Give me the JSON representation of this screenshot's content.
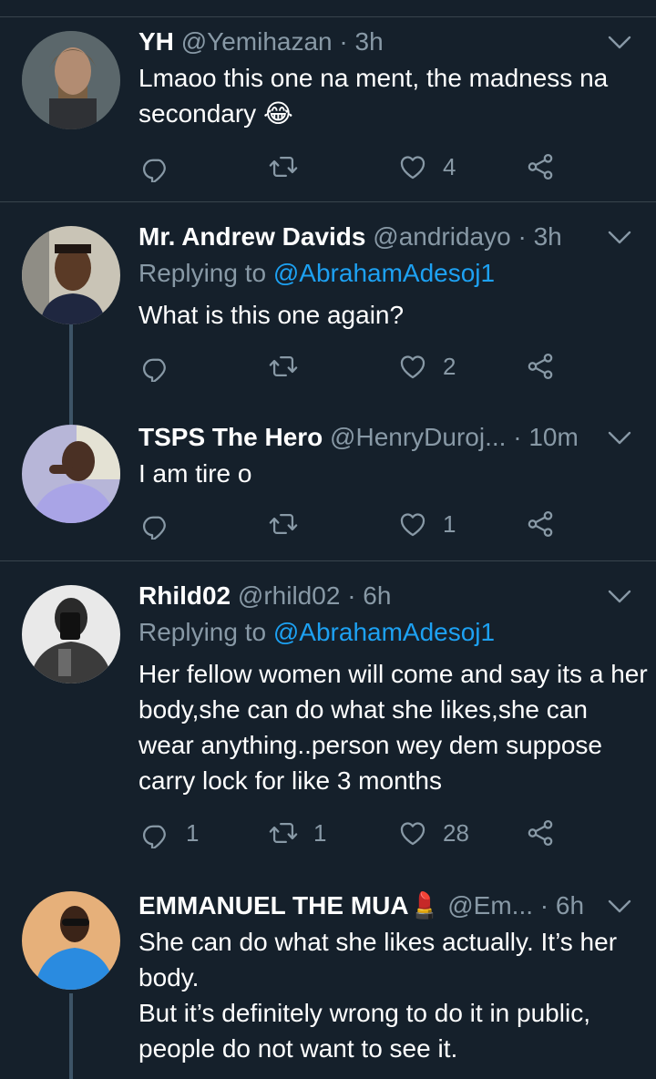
{
  "tweets": [
    {
      "name": "YH",
      "handle": "@Yemihazan",
      "time": "3h",
      "reply_to_label": "",
      "reply_to_mention": "",
      "text": "Lmaoo this one na ment, the madness na secondary 😂",
      "reply_count": "",
      "retweet_count": "",
      "like_count": "4"
    },
    {
      "name": "Mr. Andrew Davids",
      "handle": "@andridayo",
      "time": "3h",
      "reply_to_label": "Replying to ",
      "reply_to_mention": "@AbrahamAdesoj1",
      "text": "What is this one again?",
      "reply_count": "",
      "retweet_count": "",
      "like_count": "2"
    },
    {
      "name": "TSPS The Hero",
      "handle": "@HenryDuroj...",
      "time": "10m",
      "reply_to_label": "",
      "reply_to_mention": "",
      "text": "I am tire o",
      "reply_count": "",
      "retweet_count": "",
      "like_count": "1"
    },
    {
      "name": "Rhild02",
      "handle": "@rhild02",
      "time": "6h",
      "reply_to_label": "Replying to ",
      "reply_to_mention": "@AbrahamAdesoj1",
      "text": "Her fellow women will come and say its a her body,she can do what she likes,she can wear anything..person wey dem suppose carry lock for like 3 months",
      "reply_count": "1",
      "retweet_count": "1",
      "like_count": "28"
    },
    {
      "name": "EMMANUEL THE MUA💄",
      "handle": "@Em...",
      "time": "6h",
      "reply_to_label": "",
      "reply_to_mention": "",
      "text": "She can do what she likes actually. It’s her body.\nBut it’s definitely wrong to do it in public, people do not want to see it.",
      "reply_count": "",
      "retweet_count": "",
      "like_count": ""
    }
  ],
  "separator": "·",
  "icons": {
    "reply": "reply-icon",
    "retweet": "retweet-icon",
    "like": "heart-icon",
    "share": "share-icon",
    "menu": "chevron-down-icon"
  },
  "colors": {
    "background": "#15202b",
    "divider": "#38444d",
    "muted": "#8899a6",
    "link": "#1da1f2",
    "thread": "#3d5466"
  }
}
